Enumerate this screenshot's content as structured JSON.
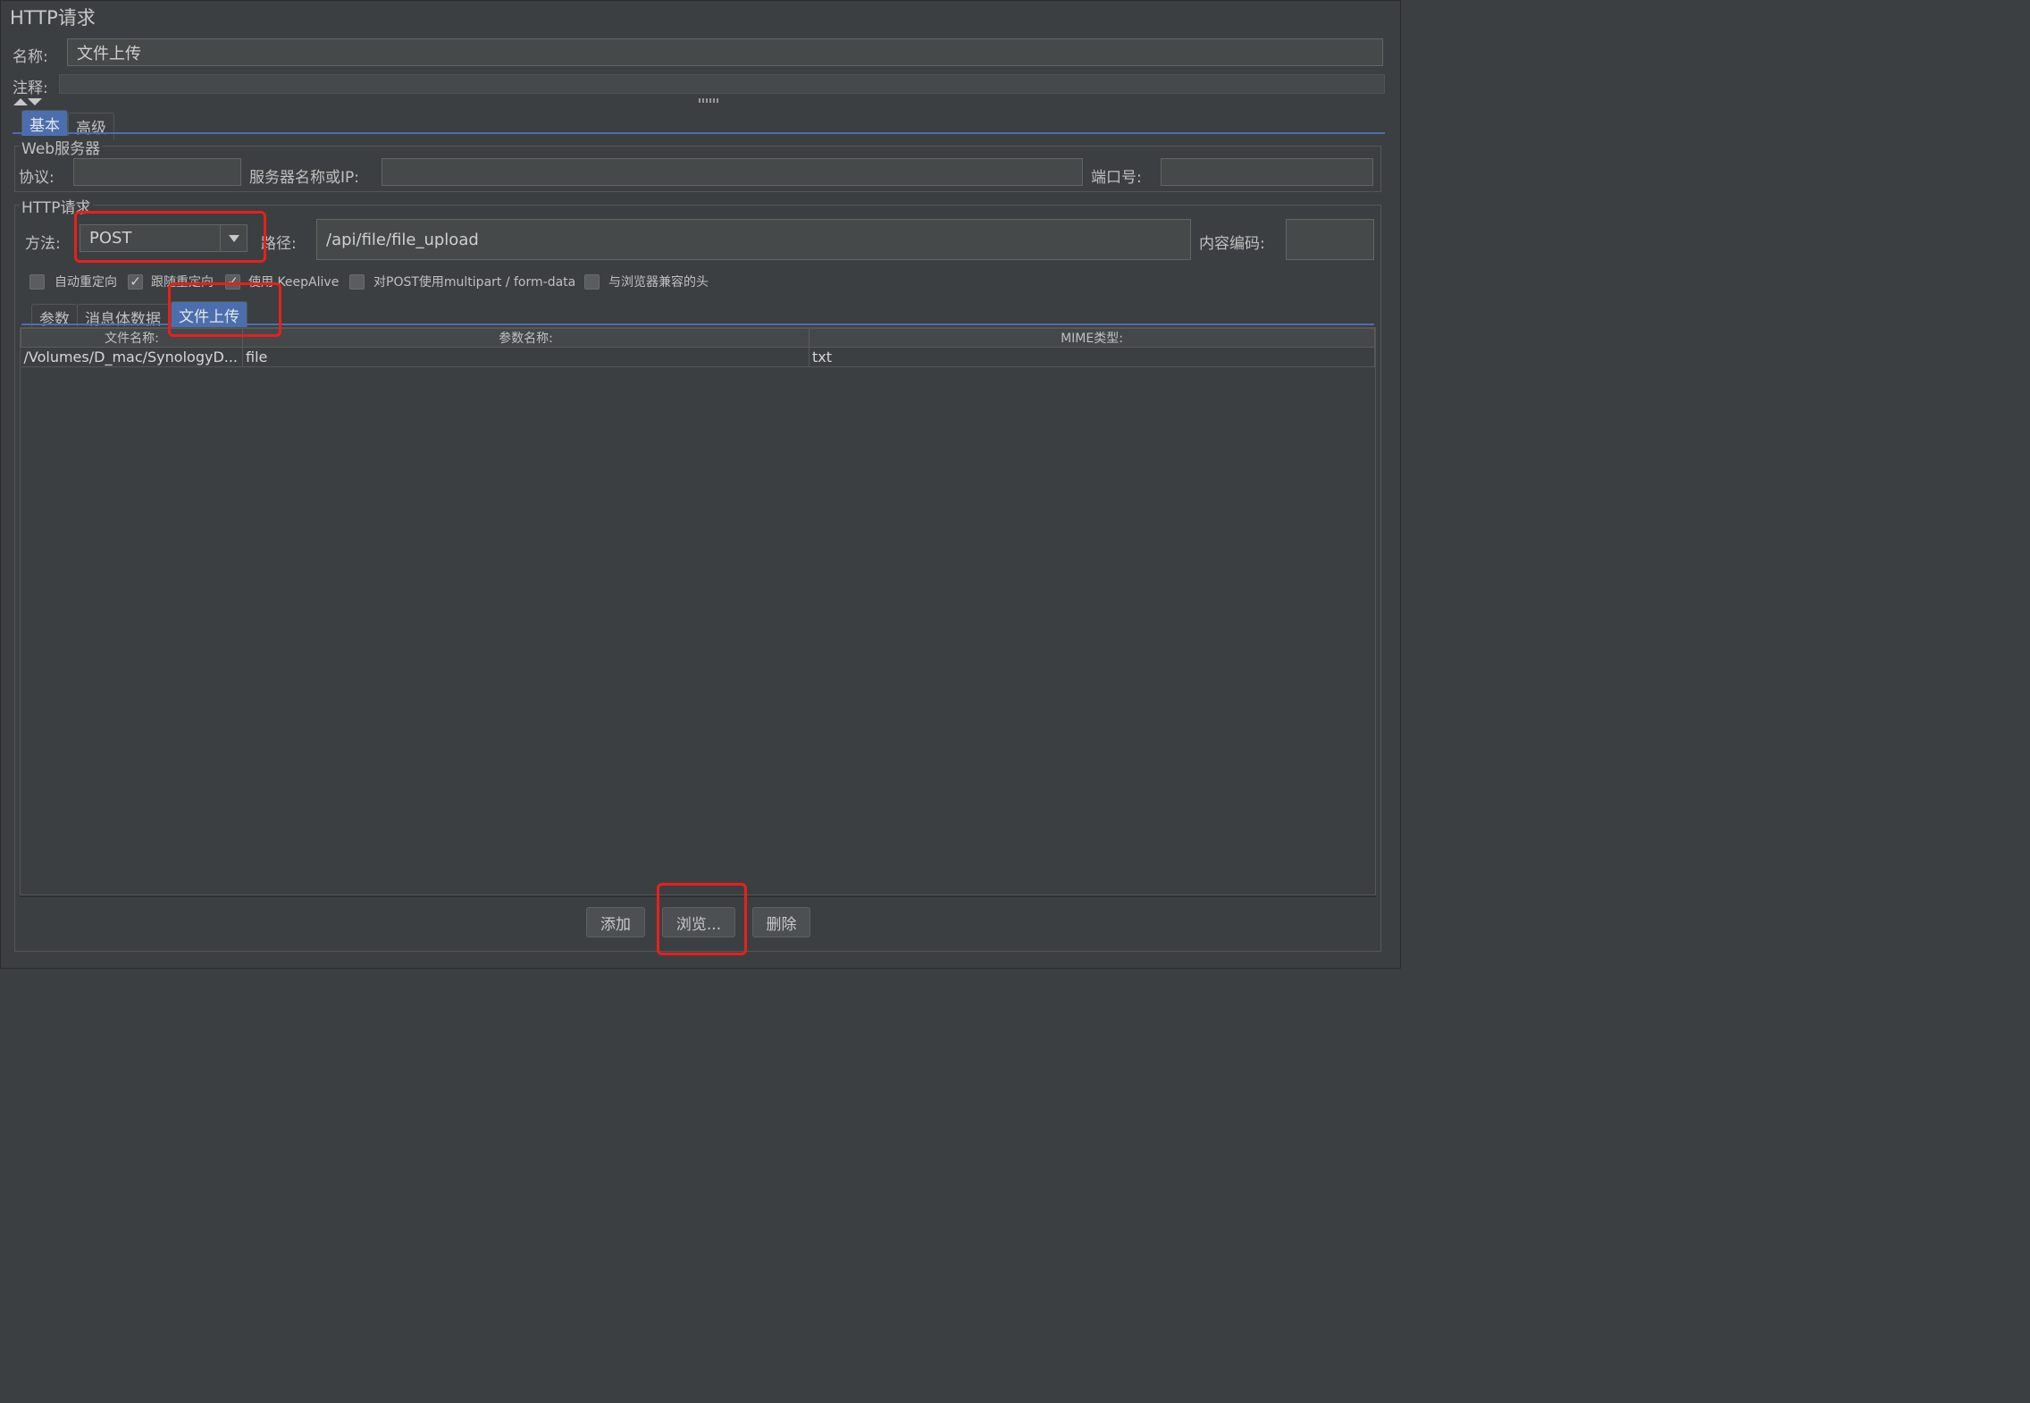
{
  "panel_title": "HTTP请求",
  "name": {
    "label": "名称:",
    "value": "文件上传"
  },
  "comment": {
    "label": "注释:",
    "value": ""
  },
  "top_tabs": [
    "基本",
    "高级"
  ],
  "web_server": {
    "group_title": "Web服务器",
    "protocol_label": "协议:",
    "protocol_value": "",
    "server_label": "服务器名称或IP:",
    "server_value": "",
    "port_label": "端口号:",
    "port_value": ""
  },
  "http_request": {
    "group_title": "HTTP请求",
    "method_label": "方法:",
    "method_value": "POST",
    "path_label": "路径:",
    "path_value": "/api/file/file_upload",
    "encoding_label": "内容编码:",
    "encoding_value": ""
  },
  "options": [
    {
      "label": "自动重定向",
      "checked": false
    },
    {
      "label": "跟随重定向",
      "checked": true
    },
    {
      "label": "使用 KeepAlive",
      "checked": true
    },
    {
      "label": "对POST使用multipart / form-data",
      "checked": false
    },
    {
      "label": "与浏览器兼容的头",
      "checked": false
    }
  ],
  "sub_tabs": [
    "参数",
    "消息体数据",
    "文件上传"
  ],
  "files_table": {
    "columns": [
      "文件名称:",
      "参数名称:",
      "MIME类型:"
    ],
    "rows": [
      [
        "/Volumes/D_mac/SynologyD...",
        "file",
        "txt"
      ]
    ]
  },
  "buttons": {
    "add": "添加",
    "browse": "浏览...",
    "delete": "删除"
  },
  "colors": {
    "background": "#3c3f41",
    "tab_active": "#4b6eaf",
    "highlight": "#e8201b"
  }
}
